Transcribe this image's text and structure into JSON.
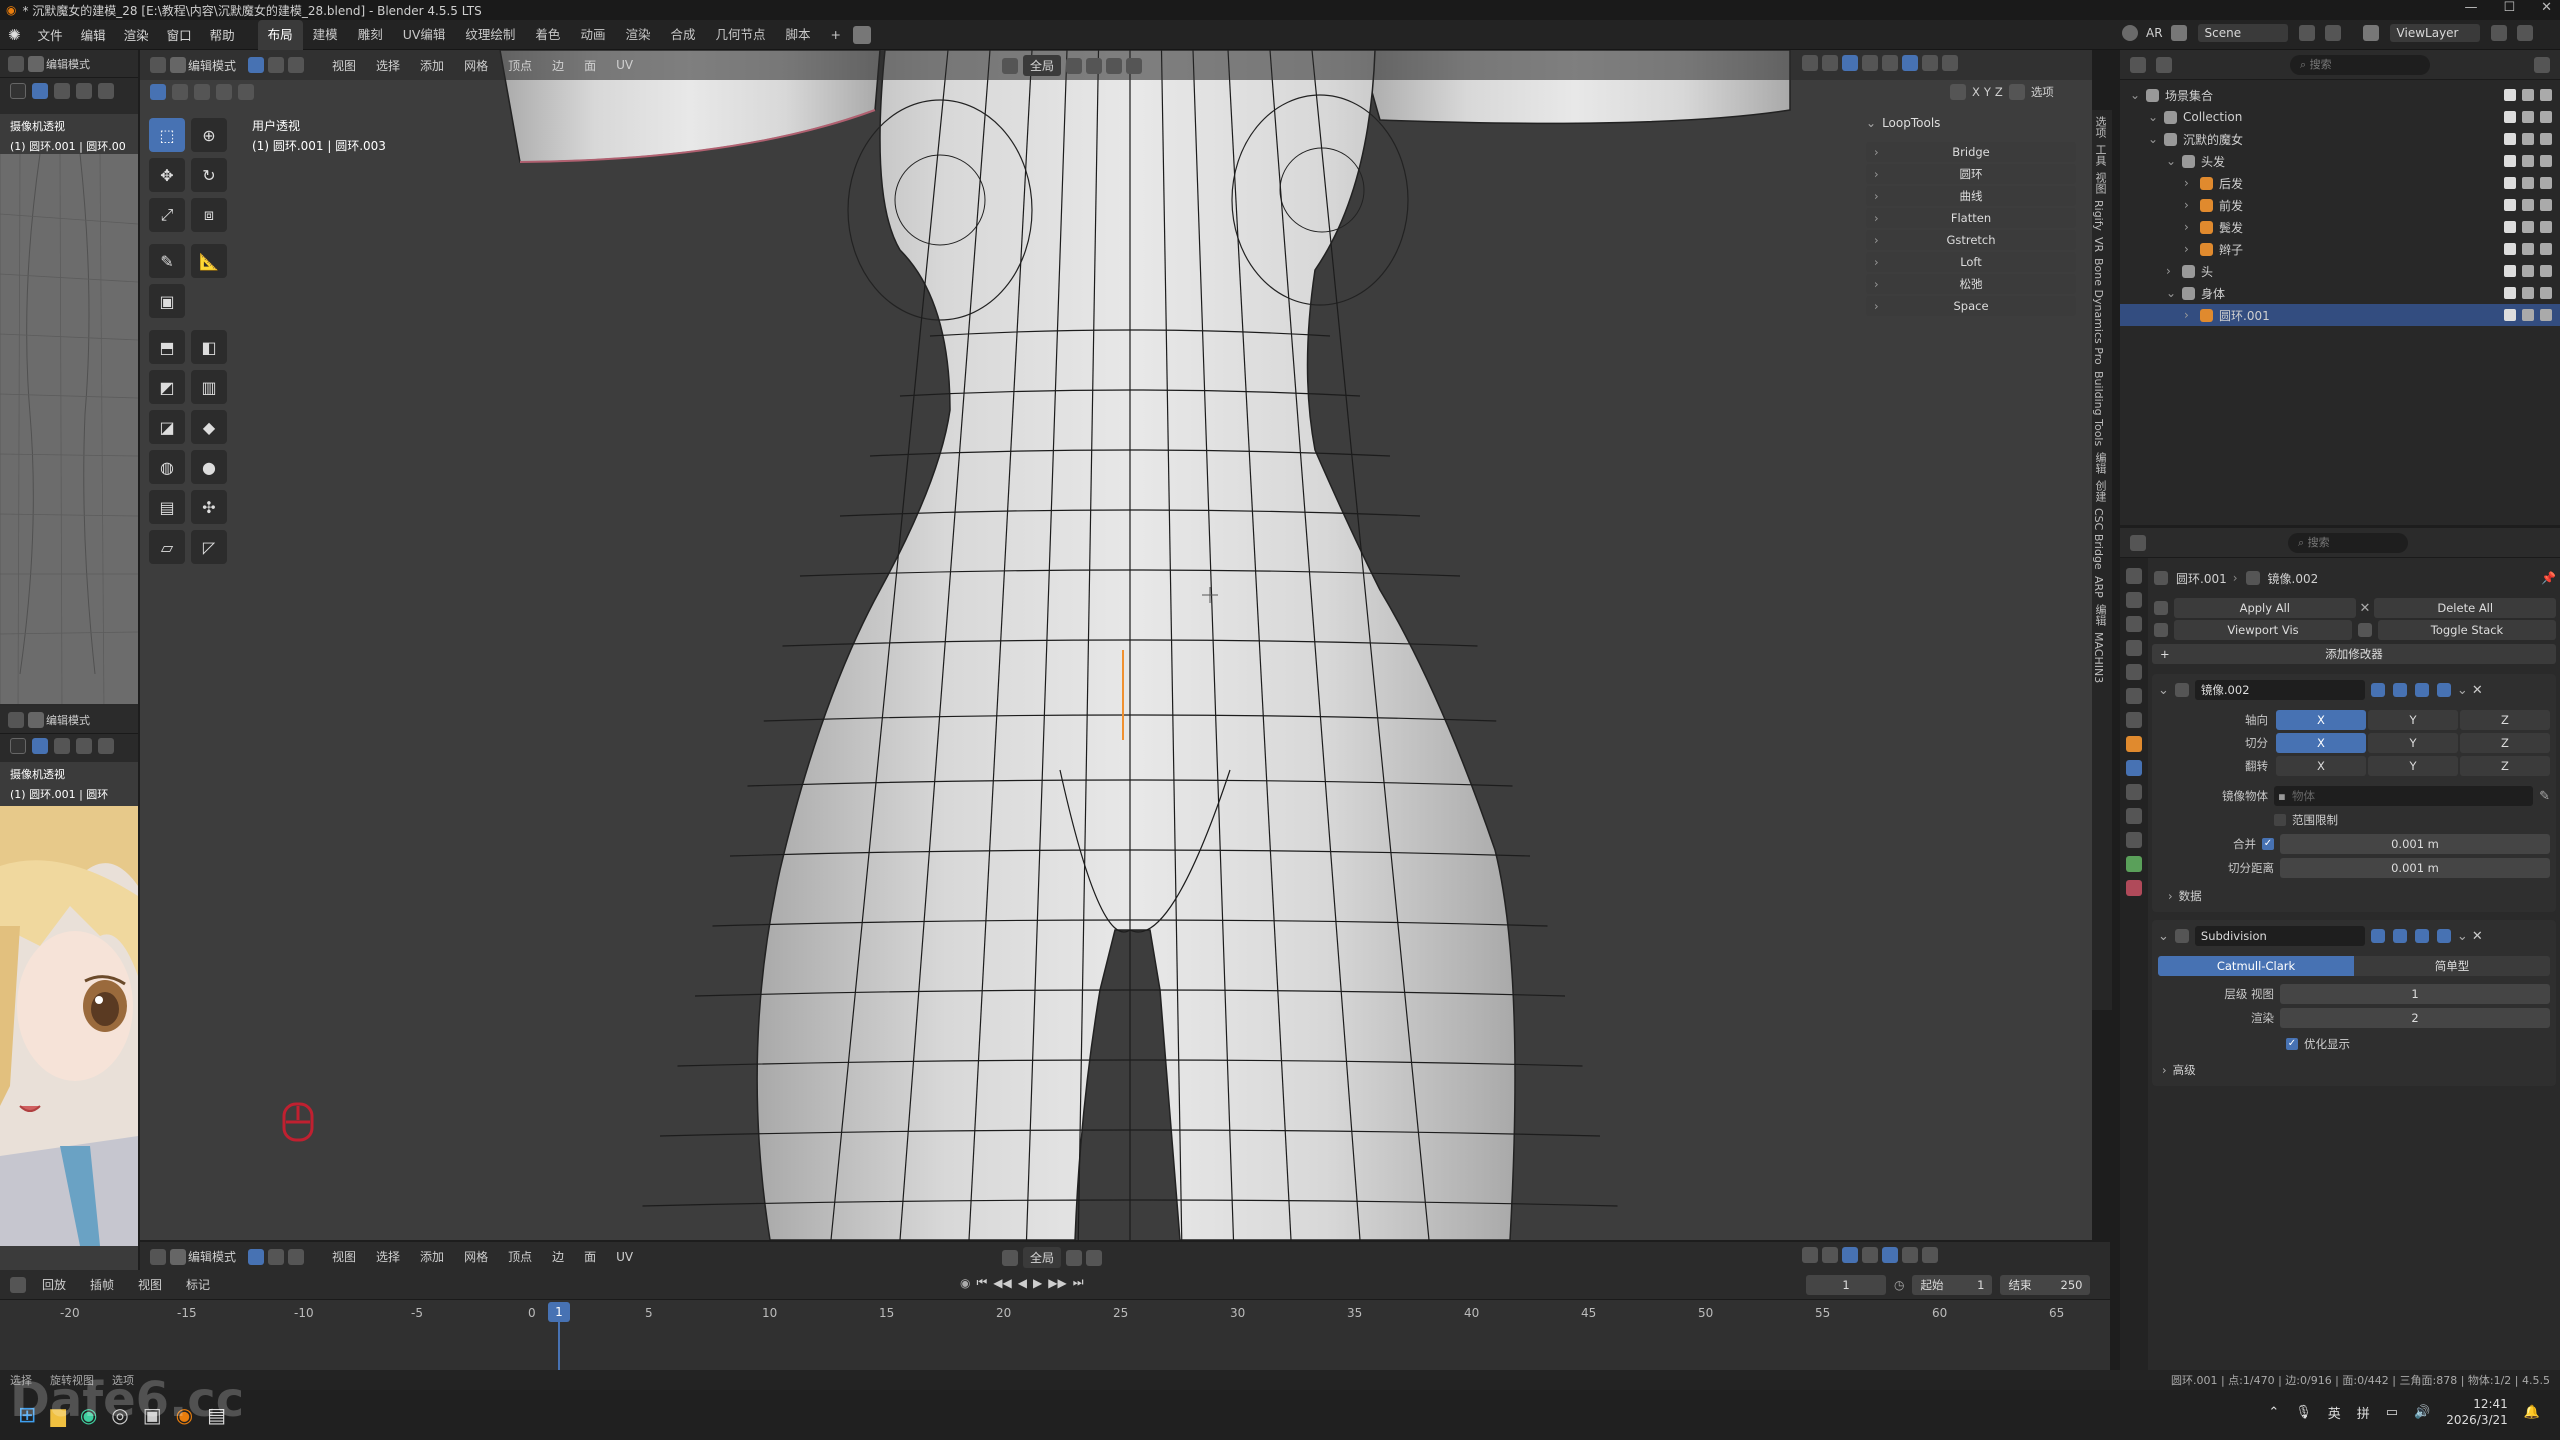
{
  "window": {
    "title": "* 沉默魔女的建模_28 [E:\\教程\\内容\\沉默魔女的建模_28.blend] - Blender 4.5.5 LTS"
  },
  "menu": {
    "items": [
      "文件",
      "编辑",
      "渲染",
      "窗口",
      "帮助"
    ],
    "workspaces": [
      "布局",
      "建模",
      "雕刻",
      "UV编辑",
      "纹理绘制",
      "着色",
      "动画",
      "渲染",
      "合成",
      "几何节点",
      "脚本"
    ],
    "add_tab": "+",
    "scene_label": "Scene",
    "viewlayer_label": "ViewLayer",
    "ar_label": "AR"
  },
  "viewport": {
    "mode": "编辑模式",
    "menus": [
      "视图",
      "选择",
      "添加",
      "网格",
      "顶点",
      "边",
      "面",
      "UV"
    ],
    "transform": "全局",
    "view_name": "用户透视",
    "object_info": "(1) 圆环.001 | 圆环.003",
    "axes": [
      "X",
      "Y",
      "Z"
    ],
    "options": "选项"
  },
  "left_panel": {
    "mode": "编辑模式",
    "view_top": "摄像机透视",
    "info_top": "(1) 圆环.001 | 圆环.00",
    "view_bottom": "摄像机透视",
    "info_bottom": "(1) 圆环.001 | 圆环"
  },
  "looptools": {
    "title": "LoopTools",
    "items": [
      "Bridge",
      "圆环",
      "曲线",
      "Flatten",
      "Gstretch",
      "Loft",
      "松弛",
      "Space"
    ]
  },
  "side_tabs": [
    "选项",
    "工具",
    "视图",
    "Rigify",
    "VR",
    "Bone Dynamics Pro",
    "Building Tools",
    "编辑",
    "创建",
    "CSC Bridge",
    "ARP",
    "编辑",
    "MACHIN3"
  ],
  "outliner": {
    "search_placeholder": "搜索",
    "rows": [
      {
        "label": "场景集合",
        "indent": 0,
        "selected": false
      },
      {
        "label": "Collection",
        "indent": 1,
        "selected": false
      },
      {
        "label": "沉默的魔女",
        "indent": 1,
        "selected": false
      },
      {
        "label": "头发",
        "indent": 2,
        "selected": false
      },
      {
        "label": "后发",
        "indent": 3,
        "selected": false
      },
      {
        "label": "前发",
        "indent": 3,
        "selected": false
      },
      {
        "label": "鬓发",
        "indent": 3,
        "selected": false
      },
      {
        "label": "辫子",
        "indent": 3,
        "selected": false
      },
      {
        "label": "头",
        "indent": 2,
        "selected": false
      },
      {
        "label": "身体",
        "indent": 2,
        "selected": false
      },
      {
        "label": "圆环.001",
        "indent": 3,
        "selected": true
      }
    ]
  },
  "properties": {
    "search_placeholder": "搜索",
    "breadcrumb_obj": "圆环.001",
    "breadcrumb_mod": "镜像.002",
    "apply_all": "Apply All",
    "delete_all": "Delete All",
    "viewport_vis": "Viewport Vis",
    "toggle_stack": "Toggle Stack",
    "add_modifier": "添加修改器",
    "mirror": {
      "name": "镜像.002",
      "rows": [
        {
          "label": "轴向",
          "x": "X",
          "y": "Y",
          "z": "Z",
          "x_on": true
        },
        {
          "label": "切分",
          "x": "X",
          "y": "Y",
          "z": "Z",
          "x_on": true
        },
        {
          "label": "翻转",
          "x": "X",
          "y": "Y",
          "z": "Z",
          "x_on": false
        }
      ],
      "mirror_object_label": "镜像物体",
      "mirror_object_placeholder": "物体",
      "clipping": "范围限制",
      "merge_label": "合并",
      "merge_value": "0.001 m",
      "bisect_label": "切分距离",
      "bisect_value": "0.001 m",
      "data": "数据"
    },
    "subdivision": {
      "name": "Subdivision",
      "mode_a": "Catmull-Clark",
      "mode_b": "简单型",
      "levels_label": "层级 视图",
      "levels_value": "1",
      "render_label": "渲染",
      "render_value": "2",
      "optimal": "优化显示",
      "advanced": "高级"
    }
  },
  "timeline": {
    "menus": [
      "回放",
      "插帧",
      "视图",
      "标记"
    ],
    "current_frame": "1",
    "start_label": "起始",
    "start_value": "1",
    "end_label": "结束",
    "end_value": "250",
    "ticks": [
      "-20",
      "-15",
      "-10",
      "-5",
      "0",
      "5",
      "10",
      "15",
      "20",
      "25",
      "30",
      "35",
      "40",
      "45",
      "50",
      "55",
      "60",
      "65"
    ]
  },
  "status": {
    "left": [
      "选择",
      "旋转视图",
      "选项"
    ],
    "right": "圆环.001 | 点:1/470 | 边:0/916 | 面:0/442 | 三角面:878 | 物体:1/2 | 4.5.5"
  },
  "taskbar": {
    "ime1": "英",
    "ime2": "拼",
    "time": "12:41",
    "date": "2026/3/21"
  },
  "watermark": "Dafe6.cc"
}
